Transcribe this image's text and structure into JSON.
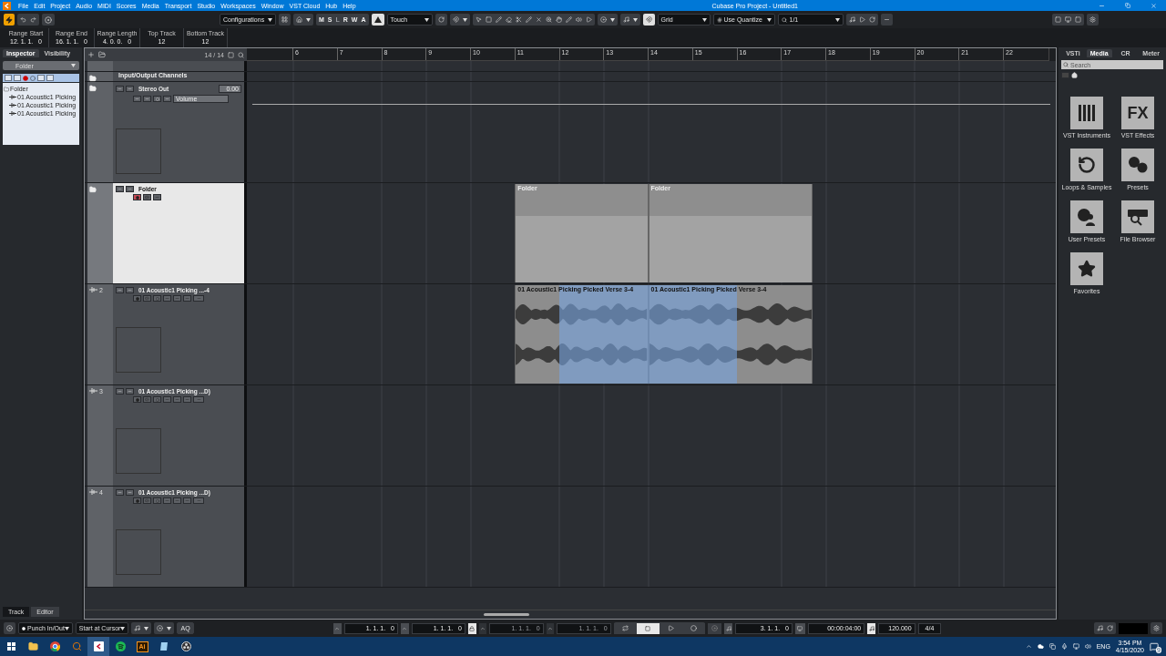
{
  "window": {
    "title": "Cubase Pro Project - Untitled1"
  },
  "menu": [
    "File",
    "Edit",
    "Project",
    "Audio",
    "MIDI",
    "Scores",
    "Media",
    "Transport",
    "Studio",
    "Workspaces",
    "Window",
    "VST Cloud",
    "Hub",
    "Help"
  ],
  "toolbar": {
    "configurations": "Configurations",
    "modes": [
      {
        "label": "M",
        "disabled": false
      },
      {
        "label": "S",
        "disabled": false
      },
      {
        "label": "L",
        "disabled": true
      },
      {
        "label": "R",
        "disabled": false
      },
      {
        "label": "W",
        "disabled": false
      },
      {
        "label": "A",
        "disabled": false
      }
    ],
    "automation_mode": "Touch",
    "snap_type": "Grid",
    "quantize_type": "Use Quantize",
    "quantize_value": "1/1"
  },
  "info_line": [
    {
      "label": "Range Start",
      "value": "12. 1. 1.   0"
    },
    {
      "label": "Range End",
      "value": "16. 1. 1.   0"
    },
    {
      "label": "Range Length",
      "value": "4. 0. 0.   0"
    },
    {
      "label": "Top Track",
      "value": "12"
    },
    {
      "label": "Bottom Track",
      "value": "12"
    }
  ],
  "inspector": {
    "tabs": [
      {
        "label": "Inspector",
        "selected": true
      },
      {
        "label": "Visibility",
        "selected": false
      }
    ],
    "section": "Folder",
    "tree": [
      {
        "label": "Folder",
        "children": [
          {
            "label": "01 Acoustic1 Picking"
          },
          {
            "label": "01 Acoustic1 Picking"
          },
          {
            "label": "01 Acoustic1 Picking"
          }
        ]
      }
    ],
    "bottom_tabs": [
      {
        "label": "Track",
        "selected": true
      },
      {
        "label": "Editor",
        "selected": false
      }
    ]
  },
  "project": {
    "track_count": "14 / 14",
    "ruler": [
      "6",
      "7",
      "8",
      "9",
      "10",
      "11",
      "12",
      "13",
      "14",
      "15",
      "16",
      "17",
      "18",
      "19",
      "20",
      "21",
      "22"
    ],
    "tracks": [
      {
        "kind": "folder",
        "name": "Input/Output Channels",
        "selected": false
      },
      {
        "kind": "output",
        "name": "Stereo Out",
        "value": "0.00",
        "parameter": "Volume",
        "selected": false
      },
      {
        "kind": "folder_track",
        "name": "Folder",
        "selected": true,
        "events": [
          {
            "label": "Folder"
          },
          {
            "label": "Folder"
          }
        ]
      },
      {
        "kind": "audio",
        "number": "2",
        "name": "01 Acoustic1 Picking ...-4",
        "selected": false,
        "range_selected": true,
        "events": [
          {
            "label": "01 Acoustic1 Picking Picked Verse 3-4"
          },
          {
            "label": "01 Acoustic1 Picking Picked Verse 3-4"
          }
        ]
      },
      {
        "kind": "audio",
        "number": "3",
        "name": "01 Acoustic1 Picking ...D)",
        "selected": false,
        "range_selected": false
      },
      {
        "kind": "audio",
        "number": "4",
        "name": "01 Acoustic1 Picking ...D)",
        "selected": false,
        "range_selected": false
      }
    ]
  },
  "media": {
    "tabs": [
      {
        "label": "VSTi",
        "selected": false
      },
      {
        "label": "Media",
        "selected": true
      },
      {
        "label": "CR",
        "selected": false
      },
      {
        "label": "Meter",
        "selected": false
      }
    ],
    "effects_glyph": "FX",
    "search": {
      "placeholder": "Search"
    },
    "checkbox": {
      "checked": false
    },
    "tiles": [
      {
        "kind": "instruments",
        "label": "VST Instruments"
      },
      {
        "kind": "effects",
        "label": "VST Effects"
      },
      {
        "kind": "loops",
        "label": "Loops & Samples"
      },
      {
        "kind": "presets",
        "label": "Presets"
      },
      {
        "kind": "user_presets",
        "label": "User Presets"
      },
      {
        "kind": "file_browser",
        "label": "File Browser"
      },
      {
        "kind": "favorites",
        "label": "Favorites"
      }
    ]
  },
  "transport": {
    "punch": "Punch In/Out",
    "start_mode": "Start at Cursor",
    "aq": "AQ",
    "locators": [
      {
        "value": "1. 1. 1.   0",
        "disabled": false
      },
      {
        "value": "1. 1. 1.   0",
        "disabled": false
      },
      {
        "value": "1. 1. 1.   0",
        "disabled": true
      },
      {
        "value": "1. 1. 1.   0",
        "disabled": true
      }
    ],
    "position": "3. 1. 1.   0",
    "time": "00:00:04:00",
    "tempo": "120.000",
    "signature": "4/4"
  },
  "taskbar": {
    "app_label": "Ai",
    "language": "ENG",
    "time": "3:54 PM",
    "date": "4/15/2020",
    "notifications": "9"
  }
}
